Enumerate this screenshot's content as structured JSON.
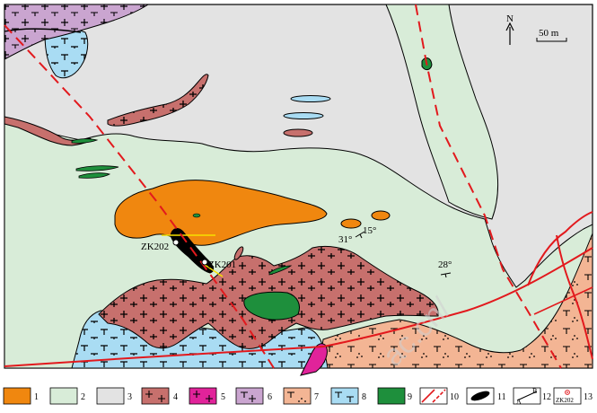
{
  "north_label": "N",
  "scale_label": "50 m",
  "drillholes": [
    {
      "id": "ZK202"
    },
    {
      "id": "ZK201"
    }
  ],
  "attitudes": [
    {
      "label_a": "31°",
      "label_b": "15°"
    },
    {
      "label_a": "28°"
    }
  ],
  "legend": [
    {
      "num": "1",
      "color": "#f0870f"
    },
    {
      "num": "2",
      "color": "#d8ecd8"
    },
    {
      "num": "3",
      "color": "#e3e3e3"
    },
    {
      "num": "4",
      "color": "#c7706d"
    },
    {
      "num": "5",
      "color": "#e1239a"
    },
    {
      "num": "6",
      "color": "#caa5d0"
    },
    {
      "num": "7",
      "color": "#f3b594"
    },
    {
      "num": "8",
      "color": "#a9dcf3"
    },
    {
      "num": "9",
      "color": "#1e8f3c"
    },
    {
      "num": "10",
      "color": "#e2191d"
    },
    {
      "num": "11",
      "color": "#000000"
    },
    {
      "num": "12",
      "sym_a": "A",
      "sym_b": "B"
    },
    {
      "num": "13",
      "sym_text": "ZK202"
    }
  ],
  "watermark": "ac.cn/"
}
